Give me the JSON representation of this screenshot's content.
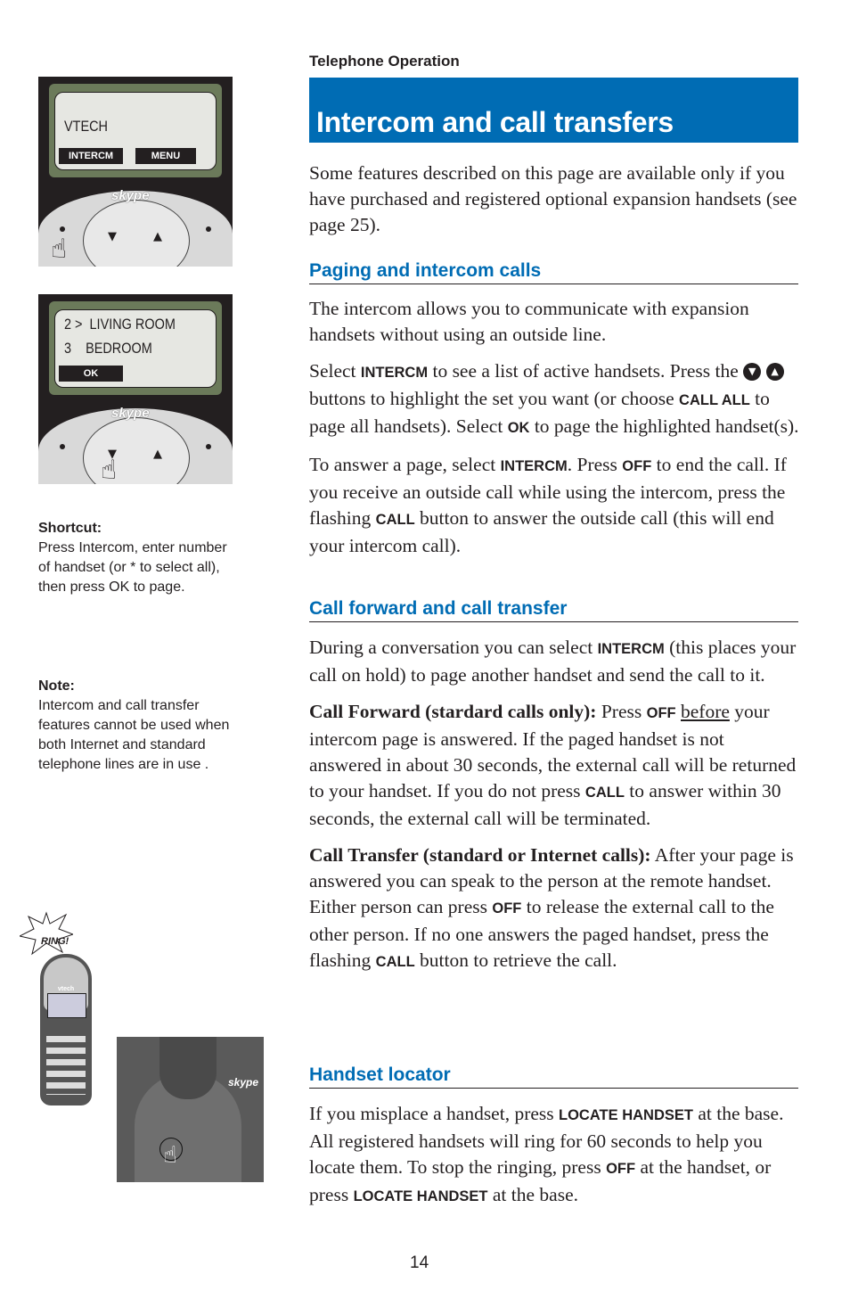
{
  "header": {
    "section": "Telephone Operation",
    "title": "Intercom and call transfers",
    "page_number": "14"
  },
  "intro": "Some features described on this page are available only if you have purchased and registered optional expansion handsets (see page 25).",
  "paging": {
    "heading": "Paging and intercom calls",
    "p1": "The intercom allows you to communicate with expansion handsets without using an outside line.",
    "p2": {
      "t1": "Select ",
      "k1": "INTERCM",
      "t2": " to see a list of active handsets. Press the ",
      "down_icon": "▼",
      "up_icon": "▲",
      "t3": " buttons to highlight the set you want (or choose ",
      "k2": "CALL ALL",
      "t4": " to page all handsets). Select ",
      "k3": "OK",
      "t5": " to page the highlighted handset(s)."
    },
    "p3": {
      "t1": "To answer a page, select ",
      "k1": "INTERCM",
      "t2": ". Press ",
      "k2": "OFF",
      "t3": " to end the call. If you receive an outside call while using the intercom, press the flashing ",
      "k3": "CALL",
      "t4": " button to answer the outside call (this will end your intercom call)."
    }
  },
  "forward": {
    "heading": "Call forward and call transfer",
    "p1": {
      "t1": "During a conversation you can select ",
      "k1": "INTERCM",
      "t2": " (this places your call on hold) to page another handset and send the call to it."
    },
    "p2": {
      "runin": "Call Forward (stardard calls only):",
      "t1": " Press ",
      "k1": "OFF",
      "t2": " ",
      "u1": "before",
      "t3": " your intercom page is answered. If the paged handset is not answered in about 30 seconds, the external call will be returned to your handset. If you do not press ",
      "k2": "CALL",
      "t4": " to answer within 30 seconds, the external call will be terminated."
    },
    "p3": {
      "runin": "Call Transfer (standard or Internet calls):",
      "t1": " After your page is answered you can speak to the person at the remote handset. Either person can press ",
      "k1": "OFF",
      "t2": " to release the external call to the other person. If no one answers the paged handset, press the flashing ",
      "k2": "CALL",
      "t3": " button to retrieve the call."
    }
  },
  "locator": {
    "heading": "Handset locator",
    "p1": {
      "t1": "If you misplace a handset, press ",
      "k1": "LOCATE HANDSET",
      "t2": " at the base. All registered handsets will ring for 60 seconds to help you locate them. To stop the ringing, press ",
      "k2": "OFF",
      "t3": " at the handset, or press ",
      "k3": "LOCATE HANDSET",
      "t4": " at the base."
    }
  },
  "sidebar": {
    "shortcut_heading": "Shortcut:",
    "shortcut_text": "Press Intercom, enter number of handset (or * to select all), then press OK to page.",
    "note_heading": "Note:",
    "note_text": "Intercom and call transfer features cannot be used when both Internet and standard telephone lines are in use ."
  },
  "screen1": {
    "line1": "VTECH",
    "soft_left": "INTERCM",
    "soft_right": "MENU",
    "logo": "skype"
  },
  "screen2": {
    "line1": "2 >  LIVING ROOM",
    "line2": "3    BEDROOM",
    "soft_left": "OK",
    "logo": "skype"
  },
  "illustration": {
    "ring_label": "RING!",
    "brand": "vtech",
    "base_logo": "skype"
  },
  "colors": {
    "accent": "#006cb4",
    "text": "#231f20"
  }
}
